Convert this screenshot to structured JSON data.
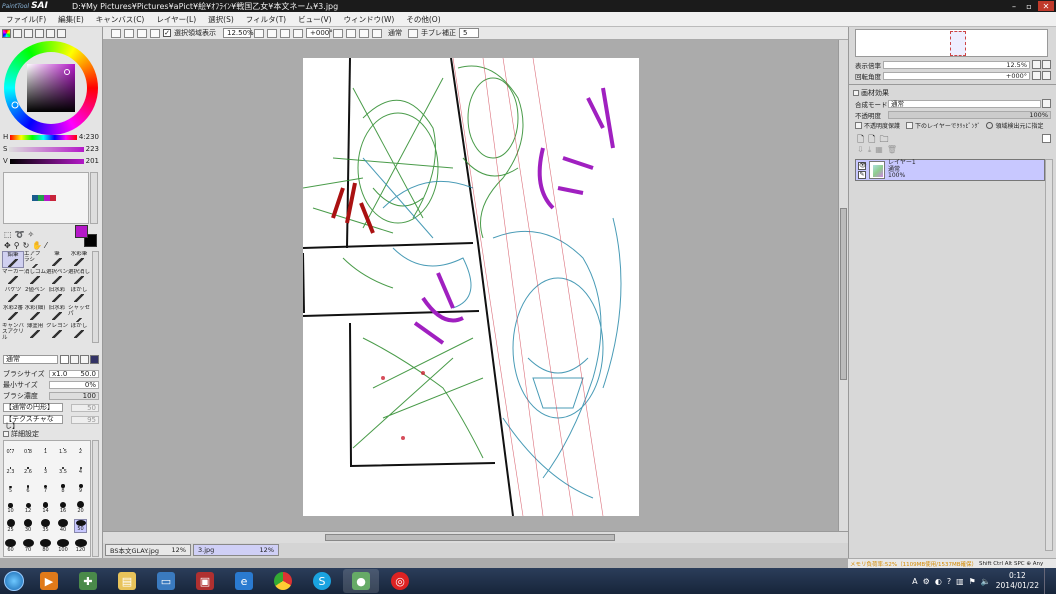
{
  "window": {
    "logo_small": "PaintTool",
    "logo_big": "SAI",
    "title": "D:¥My Pictures¥Pictures¥aPict¥絵¥ｵﾌﾗｲﾝ¥戦国乙女¥本文ネーム¥3.jpg"
  },
  "menu": [
    "ファイル(F)",
    "編集(E)",
    "キャンバス(C)",
    "レイヤー(L)",
    "選択(S)",
    "フィルタ(T)",
    "ビュー(V)",
    "ウィンドウ(W)",
    "その他(O)"
  ],
  "toolbar": {
    "selection_display_label": "選択領域表示",
    "zoom": "12.50%",
    "rotation": "+000°",
    "blend": "通常",
    "stabilizer_label": "手ブレ補正",
    "stabilizer_value": "5"
  },
  "color": {
    "current_hex": "#b418c8",
    "secondary_hex": "#000000",
    "h_label": "H",
    "h_value": "4:230",
    "s_label": "S",
    "s_value": "223",
    "v_label": "V",
    "v_value": "201",
    "swatches": [
      "#1a5c8c",
      "#21a24a",
      "#b418c8",
      "#c8243a"
    ]
  },
  "tools": [
    {
      "label": "鉛筆",
      "icon": "pencil-icon"
    },
    {
      "label": "エアブラシ",
      "icon": "airbrush-icon"
    },
    {
      "label": "筆",
      "icon": "brush-icon"
    },
    {
      "label": "水彩筆",
      "icon": "watercolor-icon"
    },
    {
      "label": "マーカー",
      "icon": "marker-icon"
    },
    {
      "label": "消しゴム",
      "icon": "eraser-icon"
    },
    {
      "label": "選択ペン",
      "icon": "select-pen-icon"
    },
    {
      "label": "選択消し",
      "icon": "select-eraser-icon"
    },
    {
      "label": "バケツ",
      "icon": "bucket-icon"
    },
    {
      "label": "2値ペン",
      "icon": "binary-pen-icon"
    },
    {
      "label": "旧水彩",
      "icon": "old-watercolor-icon"
    },
    {
      "label": "ぼかし",
      "icon": "blur-icon"
    },
    {
      "label": "水彩2番",
      "icon": "watercolor2-icon"
    },
    {
      "label": "水彩(細)",
      "icon": "watercolor-fine-icon"
    },
    {
      "label": "旧水彩",
      "icon": "old-watercolor2-icon"
    },
    {
      "label": "シャッセパ",
      "icon": "custom-icon"
    },
    {
      "label": "キャンバスアクリル",
      "icon": "acrylic-icon"
    },
    {
      "label": "薄塗用",
      "icon": "thin-icon"
    },
    {
      "label": "クレヨン",
      "icon": "crayon-icon"
    },
    {
      "label": "ぼかし",
      "icon": "blur2-icon"
    }
  ],
  "brush": {
    "mode": "通常",
    "size_label": "ブラシサイズ",
    "size_mult": "x1.0",
    "size_value": "50.0",
    "min_size_label": "最小サイズ",
    "min_size_value": "0%",
    "density_label": "ブラシ濃度",
    "density_value": "100",
    "shape_label": "【通常の円形】",
    "shape_value": "50",
    "texture_label": "【テクスチャなし】",
    "texture_value": "95",
    "detail_label": "詳細設定"
  },
  "brush_sizes": [
    "0.7",
    "0.8",
    "1",
    "1.5",
    "2",
    "2.3",
    "2.6",
    "3",
    "3.5",
    "4",
    "5",
    "6",
    "7",
    "8",
    "9",
    "10",
    "12",
    "14",
    "16",
    "20",
    "25",
    "30",
    "35",
    "40",
    "50",
    "60",
    "70",
    "80",
    "100",
    "120"
  ],
  "navigator": {
    "zoom_label": "表示倍率",
    "zoom_value": "12.5%",
    "angle_label": "回転角度",
    "angle_value": "+000°"
  },
  "layer_panel": {
    "effect_label": "画材効果",
    "blend_label": "合成モード",
    "blend_value": "通常",
    "opacity_label": "不透明度",
    "opacity_value": "100%",
    "preserve_opacity": "不透明度保護",
    "clip_lower": "下のレイヤーでｸﾘｯﾋﾟﾝｸﾞ",
    "specify_source": "領域検出元に指定",
    "layer_name": "レイヤー1",
    "layer_mode": "通常",
    "layer_opacity": "100%"
  },
  "doc_tabs": [
    {
      "name": "BS本文GLAY.jpg",
      "zoom": "12%"
    },
    {
      "name": "3.jpg",
      "zoom": "12%"
    }
  ],
  "status": {
    "memory": "メモリ負荷率:52%（1109MB使用/1537MB確保）",
    "keys": "Shift Ctrl Alt SPC ⊕ Any"
  },
  "taskbar": {
    "clock_time": "0:12",
    "clock_date": "2014/01/22",
    "ime": "A"
  }
}
